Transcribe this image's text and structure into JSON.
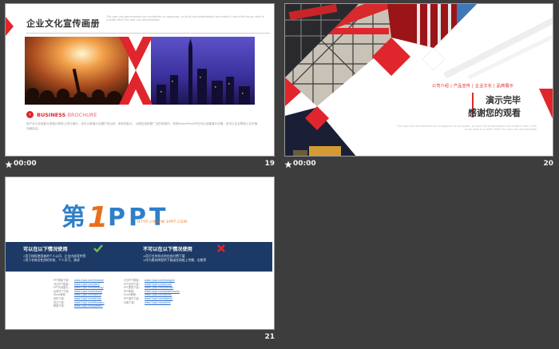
{
  "slides": [
    {
      "number": "19",
      "time": "00:00",
      "title": "企业文化宣传画册",
      "header_note": "The user can demonstrate on a projector or computer, or print the presentation and make it into a film to be used in a wider field The user can demonstrate",
      "brochure_heading": "BUSINESS",
      "brochure_heading_light": "BROCHURE",
      "body_text": "用户可以在投影仪或者计算机上进行演示，也可以将演示文稿打印出来，制作成胶片，以便应用到更广泛的领域中。利用PowerPoint不仅可以创建演示文稿，还可以在互联网上召开面对面会议。"
    },
    {
      "number": "20",
      "time": "00:00",
      "nav_text": "公司介绍 | 产品宣传 | 企业文化 | 品牌展示",
      "line1": "演示完毕",
      "line2": "感谢您的观看",
      "small_text": "The user can demonstrate on a projector or computer, or print the presentation and make it into a film to be used in a wider field The user can demonstrate"
    },
    {
      "number": "21",
      "logo_text": "第1PPT",
      "logo_url": "HTTP://WWW.1PPT.COM",
      "can_heading": "可以在以下情况使用",
      "can_items": [
        "√用于授权使用者的个人公司、企业内部宣传等",
        "√用于非商业性质的学校、个人学习、演讲"
      ],
      "cannot_heading": "不可以在以下情况使用",
      "cannot_items": [
        "×用于任何形式的在线付费下载",
        "×作为素材库提供下载或在网络上传播、出售等"
      ],
      "links_left": [
        {
          "k": "PPT模板下载：",
          "v": "www.1ppt.com/moban/"
        },
        {
          "k": "节日PPT模板：",
          "v": "www.1ppt.com/jieri/"
        },
        {
          "k": "PPT背景图片：",
          "v": "www.1ppt.com/beijing/"
        },
        {
          "k": "优秀PPT下载：",
          "v": "www.1ppt.com/xiazai/"
        },
        {
          "k": "Word教程：",
          "v": "www.1ppt.com/word/"
        },
        {
          "k": "资料下载：",
          "v": "www.1ppt.com/ziliao/"
        },
        {
          "k": "范文下载：",
          "v": "www.1ppt.com/fanwen/"
        },
        {
          "k": "教案下载：",
          "v": "www.1ppt.com/jiaoan/"
        }
      ],
      "links_right": [
        {
          "k": "行业PPT模板：",
          "v": "www.1ppt.com/hangye/"
        },
        {
          "k": "PPT素材下载：",
          "v": "www.1ppt.com/sucai/"
        },
        {
          "k": "PPT图表下载：",
          "v": "www.1ppt.com/tubiao/"
        },
        {
          "k": "PPT教程：",
          "v": "www.1ppt.com/powerpoint/"
        },
        {
          "k": "Excel教程：",
          "v": "www.1ppt.com/excel/"
        },
        {
          "k": "PPT课件下载：",
          "v": "www.1ppt.com/kejian/"
        },
        {
          "k": "试卷下载：",
          "v": "www.1ppt.com/shiti/"
        }
      ]
    }
  ],
  "colors": {
    "accent": "#e0262c",
    "band": "#1d3a66",
    "background": "#3d3d3d",
    "logo_blue": "#2f7fc8",
    "logo_orange": "#e8701a"
  },
  "icons": [
    "star-icon",
    "check-icon",
    "cross-icon",
    "arrow-right-icon"
  ]
}
